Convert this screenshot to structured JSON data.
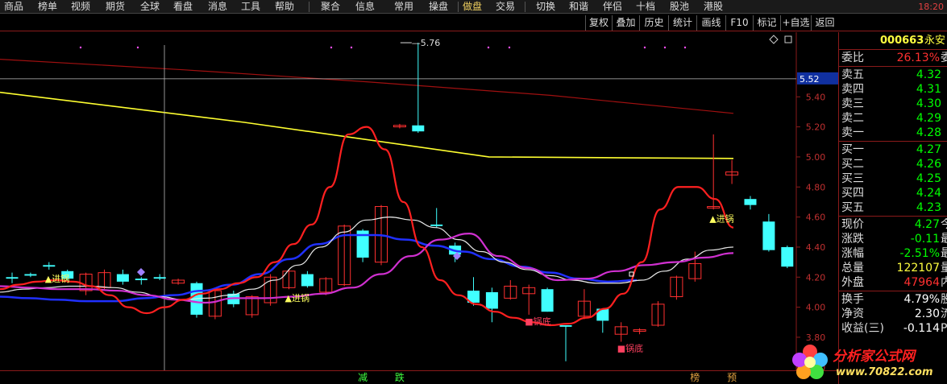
{
  "menu": [
    "商品",
    "榜单",
    "视频",
    "期货",
    "全球",
    "看盘",
    "消息",
    "工具",
    "帮助",
    "聚合",
    "信息",
    "常用",
    "操盘",
    "做盘",
    "交易",
    "切换",
    "和谐",
    "伴侣",
    "十档",
    "股池",
    "港股"
  ],
  "menu_active": 13,
  "clock": "18:20",
  "toolbar": [
    "复权",
    "叠加",
    "历史",
    "统计",
    "画线",
    "F10",
    "标记",
    "+自选",
    "返回"
  ],
  "stock": {
    "code": "000663",
    "name": "永安"
  },
  "quote": {
    "weibi": {
      "label": "委比",
      "value": "26.13%",
      "cut": "委"
    },
    "asks": [
      {
        "label": "卖五",
        "price": "4.32"
      },
      {
        "label": "卖四",
        "price": "4.31"
      },
      {
        "label": "卖三",
        "price": "4.30"
      },
      {
        "label": "卖二",
        "price": "4.29"
      },
      {
        "label": "卖一",
        "price": "4.28"
      }
    ],
    "bids": [
      {
        "label": "买一",
        "price": "4.27"
      },
      {
        "label": "买二",
        "price": "4.26"
      },
      {
        "label": "买三",
        "price": "4.25"
      },
      {
        "label": "买四",
        "price": "4.24"
      },
      {
        "label": "买五",
        "price": "4.23"
      }
    ],
    "stats": [
      {
        "label": "现价",
        "value": "4.27",
        "cut": "今",
        "color": "#00ff00"
      },
      {
        "label": "涨跌",
        "value": "-0.11",
        "cut": "最",
        "color": "#00ff00"
      },
      {
        "label": "涨幅",
        "value": "-2.51%",
        "cut": "最",
        "color": "#00ff00"
      },
      {
        "label": "总量",
        "value": "122107",
        "cut": "量",
        "color": "#ffff40"
      },
      {
        "label": "外盘",
        "value": "47964",
        "cut": "内",
        "color": "#ff3030"
      }
    ],
    "extra": [
      {
        "label": "换手",
        "value": "4.79%",
        "cut": "股"
      },
      {
        "label": "净资",
        "value": "2.30",
        "cut": "流"
      },
      {
        "label": "收益(三)",
        "value": "-0.114",
        "cut": "PE"
      }
    ]
  },
  "colors": {
    "up": "#ff3030",
    "down": "#40ffff",
    "ma_red": "#ff2020",
    "ma_white": "#e8e8e8",
    "ma_blue": "#2030ff",
    "ma_magenta": "#d030d0",
    "ma_yellow": "#ffff30",
    "ma_darkred": "#a01010",
    "signal": "#ffff60"
  },
  "chart_data": {
    "type": "candlestick",
    "y_ticks": [
      "5.40",
      "5.20",
      "5.00",
      "4.80",
      "4.60",
      "4.40",
      "4.20",
      "4.00",
      "3.80",
      "3.60"
    ],
    "ylim": [
      3.58,
      5.83
    ],
    "cursor_price": "5.52",
    "high_label": "5.76",
    "candles": [
      {
        "o": 4.2,
        "c": 4.19,
        "h": 4.23,
        "l": 4.16
      },
      {
        "o": 4.22,
        "c": 4.21,
        "h": 4.23,
        "l": 4.2
      },
      {
        "o": 4.28,
        "c": 4.27,
        "h": 4.3,
        "l": 4.25
      },
      {
        "o": 4.24,
        "c": 4.19,
        "h": 4.25,
        "l": 4.18
      },
      {
        "o": 4.11,
        "c": 4.22,
        "h": 4.23,
        "l": 4.08
      },
      {
        "o": 4.13,
        "c": 4.23,
        "h": 4.25,
        "l": 4.12
      },
      {
        "o": 4.22,
        "c": 4.17,
        "h": 4.25,
        "l": 4.15
      },
      {
        "o": 4.19,
        "c": 4.18,
        "h": 4.2,
        "l": 4.15
      },
      {
        "o": 4.2,
        "c": 4.19,
        "h": 4.22,
        "l": 4.18
      },
      {
        "o": 4.16,
        "c": 4.18,
        "h": 4.19,
        "l": 4.15
      },
      {
        "o": 4.16,
        "c": 3.95,
        "h": 4.17,
        "l": 3.93
      },
      {
        "o": 3.94,
        "c": 4.11,
        "h": 4.13,
        "l": 3.92
      },
      {
        "o": 4.09,
        "c": 4.02,
        "h": 4.11,
        "l": 4.0
      },
      {
        "o": 3.95,
        "c": 4.07,
        "h": 4.08,
        "l": 3.93
      },
      {
        "o": 4.03,
        "c": 4.2,
        "h": 4.22,
        "l": 4.01
      },
      {
        "o": 4.13,
        "c": 4.24,
        "h": 4.25,
        "l": 4.12
      },
      {
        "o": 4.22,
        "c": 4.14,
        "h": 4.24,
        "l": 4.13
      },
      {
        "o": 4.1,
        "c": 4.19,
        "h": 4.2,
        "l": 4.08
      },
      {
        "o": 4.15,
        "c": 4.54,
        "h": 4.55,
        "l": 4.14
      },
      {
        "o": 4.51,
        "c": 4.33,
        "h": 4.52,
        "l": 4.3
      },
      {
        "o": 4.3,
        "c": 4.67,
        "h": 4.68,
        "l": 4.28
      },
      {
        "o": 5.2,
        "c": 5.21,
        "h": 5.22,
        "l": 5.19
      },
      {
        "o": 5.21,
        "c": 5.17,
        "h": 5.76,
        "l": 5.16
      },
      {
        "o": 4.55,
        "c": 4.54,
        "h": 4.66,
        "l": 4.53
      },
      {
        "o": 4.41,
        "c": 4.35,
        "h": 4.43,
        "l": 4.3
      },
      {
        "o": 4.11,
        "c": 4.03,
        "h": 4.2,
        "l": 4.01
      },
      {
        "o": 4.1,
        "c": 3.99,
        "h": 4.13,
        "l": 3.9
      },
      {
        "o": 4.06,
        "c": 4.14,
        "h": 4.18,
        "l": 4.05
      },
      {
        "o": 4.09,
        "c": 4.13,
        "h": 4.15,
        "l": 3.95
      },
      {
        "o": 4.12,
        "c": 3.97,
        "h": 4.13,
        "l": 3.97
      },
      {
        "o": 3.88,
        "c": 3.87,
        "h": 3.88,
        "l": 3.64
      },
      {
        "o": 3.94,
        "c": 4.04,
        "h": 4.12,
        "l": 3.92
      },
      {
        "o": 3.99,
        "c": 3.91,
        "h": 3.99,
        "l": 3.83
      },
      {
        "o": 3.82,
        "c": 3.87,
        "h": 3.9,
        "l": 3.77
      },
      {
        "o": 3.84,
        "c": 3.85,
        "h": 3.86,
        "l": 3.82
      },
      {
        "o": 3.88,
        "c": 4.02,
        "h": 4.04,
        "l": 3.87
      },
      {
        "o": 4.07,
        "c": 4.2,
        "h": 4.21,
        "l": 4.05
      },
      {
        "o": 4.19,
        "c": 4.29,
        "h": 4.37,
        "l": 4.17
      },
      {
        "o": 4.66,
        "c": 4.67,
        "h": 5.15,
        "l": 4.65
      },
      {
        "o": 4.88,
        "c": 4.9,
        "h": 4.98,
        "l": 4.82
      },
      {
        "o": 4.72,
        "c": 4.68,
        "h": 4.74,
        "l": 4.65
      },
      {
        "o": 4.57,
        "c": 4.38,
        "h": 4.62,
        "l": 4.37
      },
      {
        "o": 4.4,
        "c": 4.27,
        "h": 4.41,
        "l": 4.26
      }
    ],
    "ma_red": [
      4.12,
      4.15,
      4.17,
      4.18,
      4.17,
      4.14,
      4.08,
      4.0,
      3.96,
      4.0,
      4.05,
      4.09,
      4.12,
      4.16,
      4.2,
      4.3,
      4.42,
      4.55,
      4.8,
      5.15,
      5.2,
      5.05,
      4.7,
      4.4,
      4.18,
      4.08,
      4.02,
      3.97,
      3.93,
      3.9,
      3.88,
      3.89,
      3.93,
      3.99,
      4.09,
      4.3,
      4.65,
      4.8,
      4.8,
      4.72,
      4.53
    ],
    "ma_white": [
      4.1,
      4.12,
      4.13,
      4.14,
      4.14,
      4.13,
      4.1,
      4.07,
      4.05,
      4.06,
      4.08,
      4.12,
      4.18,
      4.28,
      4.4,
      4.5,
      4.58,
      4.6,
      4.58,
      4.53,
      4.45,
      4.37,
      4.3,
      4.25,
      4.21,
      4.18,
      4.16,
      4.16,
      4.18,
      4.24,
      4.32,
      4.38,
      4.4
    ],
    "ma_blue": [
      4.07,
      4.06,
      4.05,
      4.04,
      4.04,
      4.06,
      4.08,
      4.11,
      4.15,
      4.22,
      4.32,
      4.42,
      4.48,
      4.48,
      4.45,
      4.41,
      4.37,
      4.32,
      4.27,
      4.23,
      4.19,
      4.17,
      4.18
    ],
    "ma_magenta": [
      4.14,
      4.13,
      4.12,
      4.12,
      4.11,
      4.08,
      4.05,
      4.03,
      4.06,
      4.06,
      4.07,
      4.09,
      4.13,
      4.22,
      4.34,
      4.45,
      4.49,
      4.34,
      4.26,
      4.18,
      4.19,
      4.24,
      4.28,
      4.3,
      4.33,
      4.36
    ],
    "ma_yellow": [
      5.43,
      5.23,
      5.0,
      4.99
    ],
    "ma_darkred": [
      5.65,
      5.58,
      5.5,
      5.41,
      5.29
    ],
    "signals": [
      {
        "text": "▲进锅",
        "type": "up",
        "i": 2
      },
      {
        "text": "▲进锅",
        "type": "up",
        "i": 15
      },
      {
        "text": "■锅底",
        "type": "down",
        "i": 28
      },
      {
        "text": "■锅底",
        "type": "down",
        "i": 33
      },
      {
        "text": "▲进锅",
        "type": "up",
        "i": 38
      }
    ],
    "bottom_labels": [
      {
        "text": "减",
        "color": "#40ff40",
        "i": 19
      },
      {
        "text": "跌",
        "color": "#40ff40",
        "i": 21
      },
      {
        "text": "榜",
        "color": "#e0a040",
        "i": 37
      },
      {
        "text": "预",
        "color": "#e0a040",
        "i": 39
      }
    ]
  },
  "watermark": {
    "line1": "分析家公式网",
    "line2": "www.70822.com"
  }
}
